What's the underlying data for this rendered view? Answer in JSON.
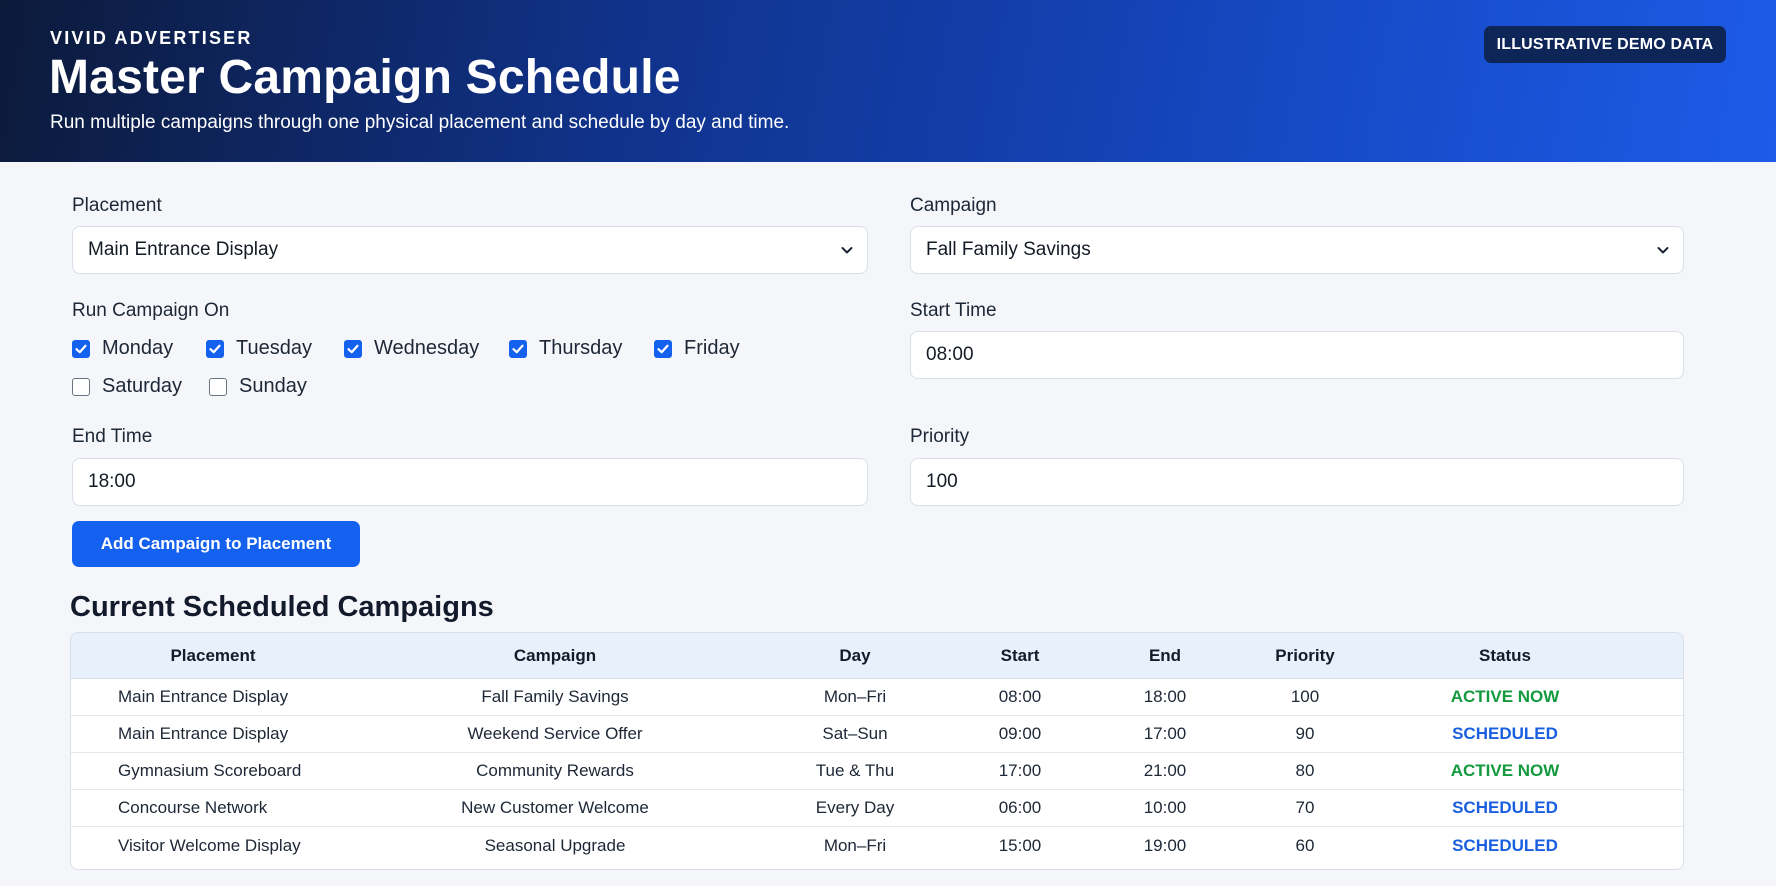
{
  "header": {
    "brand": "VIVID ADVERTISER",
    "title": "Master Campaign Schedule",
    "subtitle": "Run multiple campaigns through one physical placement and schedule by day and time.",
    "badge": "ILLUSTRATIVE DEMO DATA"
  },
  "form": {
    "placement": {
      "label": "Placement",
      "value": "Main Entrance Display"
    },
    "campaign": {
      "label": "Campaign",
      "value": "Fall Family Savings"
    },
    "run_on": {
      "label": "Run Campaign On",
      "days": [
        {
          "label": "Monday",
          "checked": true
        },
        {
          "label": "Tuesday",
          "checked": true
        },
        {
          "label": "Wednesday",
          "checked": true
        },
        {
          "label": "Thursday",
          "checked": true
        },
        {
          "label": "Friday",
          "checked": true
        },
        {
          "label": "Saturday",
          "checked": false
        },
        {
          "label": "Sunday",
          "checked": false
        }
      ]
    },
    "start_time": {
      "label": "Start Time",
      "value": "08:00"
    },
    "end_time": {
      "label": "End Time",
      "value": "18:00"
    },
    "priority": {
      "label": "Priority",
      "value": "100"
    },
    "submit_label": "Add Campaign to Placement"
  },
  "schedule": {
    "title": "Current Scheduled Campaigns",
    "columns": [
      "Placement",
      "Campaign",
      "Day",
      "Start",
      "End",
      "Priority",
      "Status"
    ],
    "rows": [
      [
        "Main Entrance Display",
        "Fall Family Savings",
        "Mon–Fri",
        "08:00",
        "18:00",
        "100",
        "ACTIVE NOW"
      ],
      [
        "Main Entrance Display",
        "Weekend Service Offer",
        "Sat–Sun",
        "09:00",
        "17:00",
        "90",
        "SCHEDULED"
      ],
      [
        "Gymnasium Scoreboard",
        "Community Rewards",
        "Tue & Thu",
        "17:00",
        "21:00",
        "80",
        "ACTIVE NOW"
      ],
      [
        "Concourse Network",
        "New Customer Welcome",
        "Every Day",
        "06:00",
        "10:00",
        "70",
        "SCHEDULED"
      ],
      [
        "Visitor Welcome Display",
        "Seasonal Upgrade",
        "Mon–Fri",
        "15:00",
        "19:00",
        "60",
        "SCHEDULED"
      ]
    ]
  },
  "colors": {
    "accent": "#1561ef",
    "status_active": "#149a3e",
    "status_scheduled": "#1a5fe0",
    "badge_bg": "#0d2557"
  },
  "icons": {
    "select_caret": "chevron-down-icon",
    "checkbox_checked": "checkmark-icon"
  }
}
